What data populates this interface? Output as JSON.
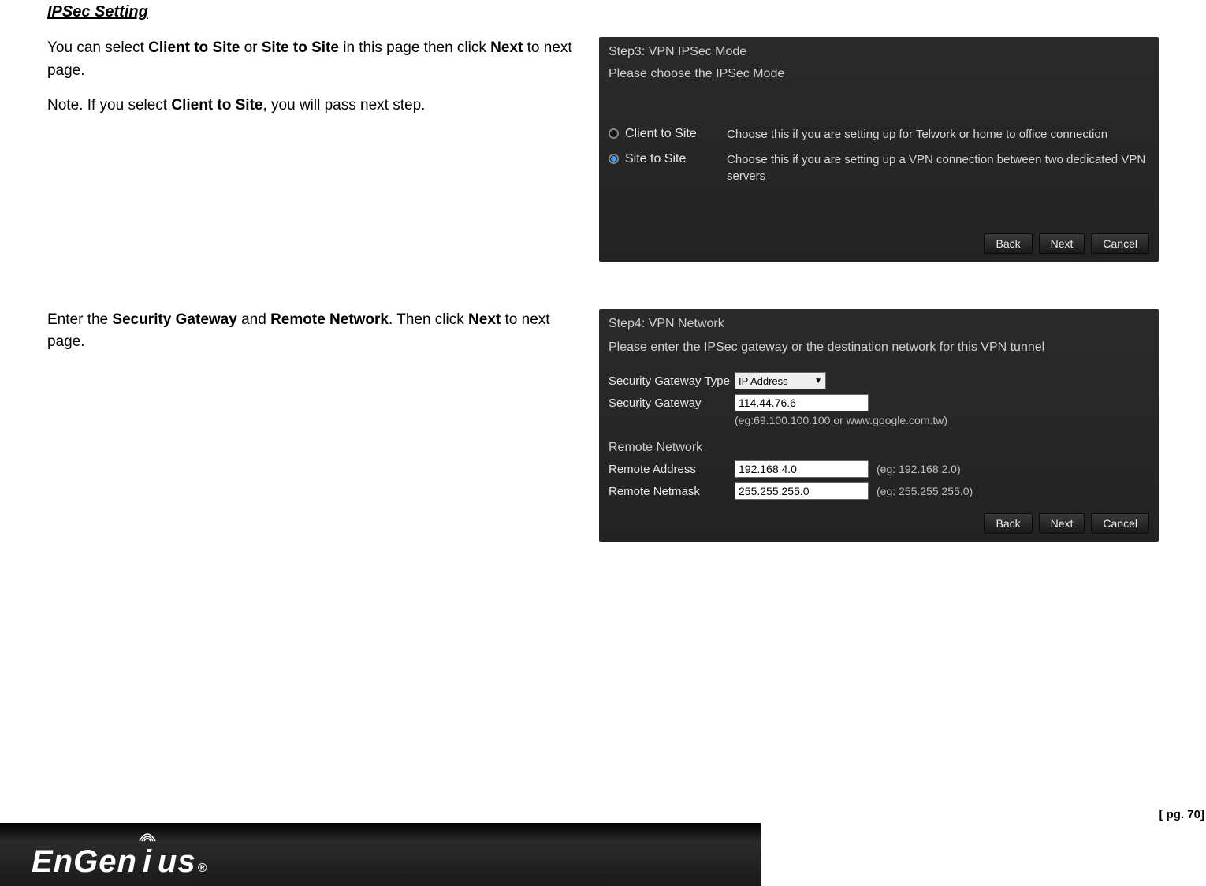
{
  "heading": "IPSec Setting",
  "para1": {
    "t1": "You can select ",
    "b1": "Client to Site",
    "t2": " or ",
    "b2": "Site to Site",
    "t3": " in this page then click ",
    "b3": "Next",
    "t4": " to next page."
  },
  "note": {
    "t1": "Note. If you select ",
    "b1": "Client to Site",
    "t2": ", you will pass next step."
  },
  "para2": {
    "t1": "Enter the ",
    "b1": "Security Gateway",
    "t2": " and ",
    "b2": "Remote Network",
    "t3": ". Then click ",
    "b3": "Next",
    "t4": " to next page."
  },
  "step3": {
    "title": "Step3: VPN IPSec Mode",
    "subtitle": "Please choose the IPSec Mode",
    "opt1_label": "Client to Site",
    "opt1_desc": "Choose this if you are setting up for Telwork or home to office connection",
    "opt2_label": "Site to Site",
    "opt2_desc": "Choose this if you are setting up a VPN connection between two dedicated VPN servers",
    "buttons": {
      "back": "Back",
      "next": "Next",
      "cancel": "Cancel"
    }
  },
  "step4": {
    "title": "Step4: VPN Network",
    "subtitle": "Please enter the IPSec gateway or the destination network for this VPN tunnel",
    "fields": {
      "gw_type_label": "Security Gateway Type",
      "gw_type_value": "IP Address",
      "gw_label": "Security Gateway",
      "gw_value": "114.44.76.6",
      "gw_hint": "(eg:69.100.100.100 or www.google.com.tw)",
      "remote_head": "Remote Network",
      "addr_label": "Remote Address",
      "addr_value": "192.168.4.0",
      "addr_hint": "(eg: 192.168.2.0)",
      "mask_label": "Remote Netmask",
      "mask_value": "255.255.255.0",
      "mask_hint": "(eg: 255.255.255.0)"
    },
    "buttons": {
      "back": "Back",
      "next": "Next",
      "cancel": "Cancel"
    }
  },
  "footer": {
    "logo_text": "EnGenius",
    "reg": "®",
    "page_label": "[ pg. 70]"
  }
}
